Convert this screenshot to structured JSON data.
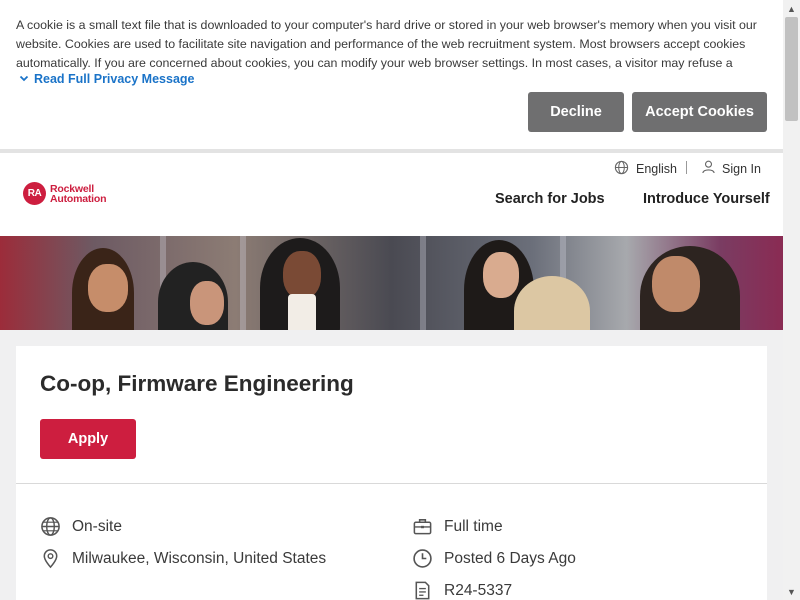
{
  "cookie_banner": {
    "text": "A cookie is a small text file that is downloaded to your computer's hard drive or stored in your web browser's memory when you visit our website. Cookies are used to facilitate site navigation and performance of the web recruitment system. Most browsers accept cookies automatically. If you are concerned about cookies, you can modify your web browser settings. In most cases, a visitor may refuse a cookie …",
    "read_more": "Read Full Privacy Message",
    "decline": "Decline",
    "accept": "Accept Cookies"
  },
  "header": {
    "logo_line1": "Rockwell",
    "logo_line2": "Automation",
    "logo_mark": "RA",
    "language": "English",
    "sign_in": "Sign In",
    "nav": [
      "Search for Jobs",
      "Introduce Yourself"
    ]
  },
  "job": {
    "title": "Co-op, Firmware Engineering",
    "apply": "Apply",
    "workplace": "On-site",
    "location": "Milwaukee, Wisconsin, United States",
    "employment_type": "Full time",
    "posted": "Posted 6 Days Ago",
    "req_id": "R24-5337"
  },
  "colors": {
    "brand_red": "#cd1e3f",
    "link_blue": "#1a73c8",
    "button_gray": "#6f6f70"
  },
  "icons": {
    "workplace": "globe-icon",
    "location": "map-pin-icon",
    "employment_type": "briefcase-icon",
    "posted": "clock-icon",
    "req_id": "document-icon",
    "language": "globe-icon",
    "sign_in": "user-icon"
  }
}
